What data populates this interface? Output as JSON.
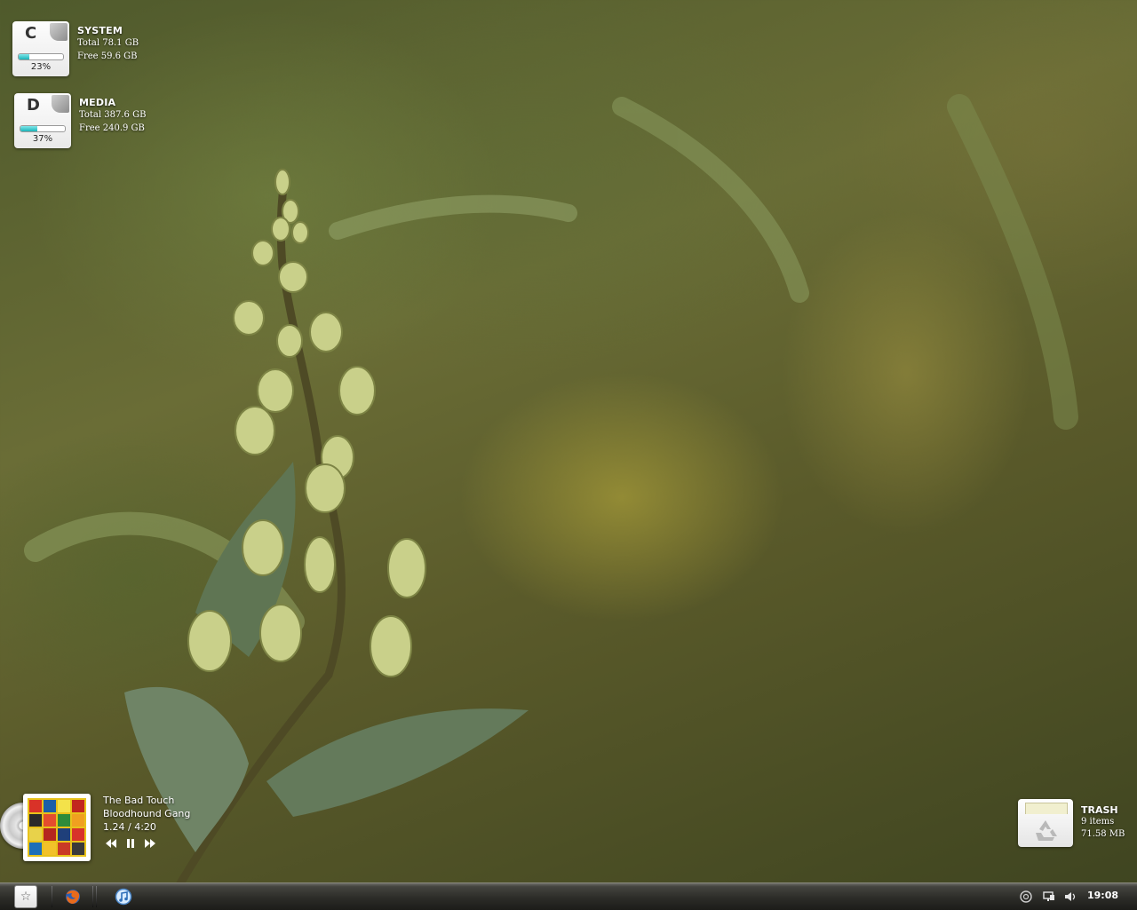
{
  "drives": [
    {
      "letter": "C",
      "name": "SYSTEM",
      "total": "Total 78.1 GB",
      "free": "Free 59.6 GB",
      "percent_label": "23%",
      "used_fraction": 0.23
    },
    {
      "letter": "D",
      "name": "MEDIA",
      "total": "Total 387.6 GB",
      "free": "Free 240.9 GB",
      "percent_label": "37%",
      "used_fraction": 0.37
    }
  ],
  "player": {
    "title": "The Bad Touch",
    "artist": "Bloodhound Gang",
    "time": "1.24 / 4:20",
    "controls": [
      "previous-icon",
      "pause-icon",
      "next-icon"
    ]
  },
  "trash": {
    "name": "TRASH",
    "items": "9 items",
    "size": "71.58 MB"
  },
  "taskbar": {
    "start_icon": "star-icon",
    "apps": [
      "firefox-icon",
      "itunes-icon"
    ],
    "tray": [
      "network-icon",
      "display-icon",
      "speaker-icon"
    ],
    "clock": "19:08"
  },
  "colors": {
    "drive_fill": "#1bb3b8",
    "taskbar": "#2c2c28"
  }
}
